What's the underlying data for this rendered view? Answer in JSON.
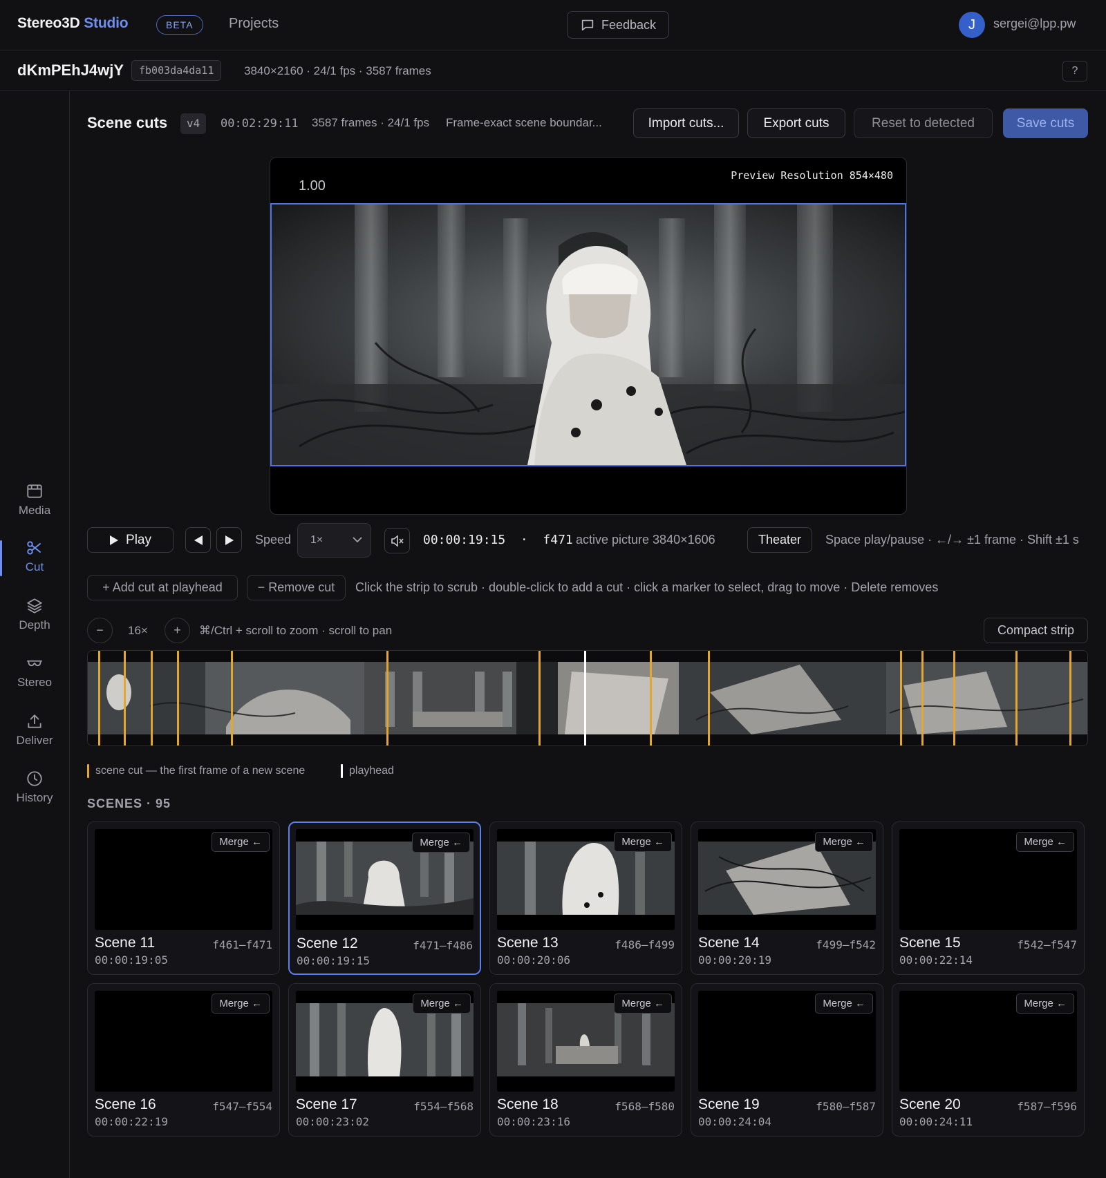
{
  "app": {
    "brand_main": "Stereo3D",
    "brand_accent": "Studio",
    "beta": "BETA",
    "projects": "Projects",
    "feedback": "Feedback",
    "avatar_initial": "J",
    "user_email": "sergei@lpp.pw"
  },
  "asset": {
    "name": "dKmPEhJ4wjY",
    "hash": "fb003da4da11",
    "meta": "3840×2160 · 24/1 fps · 3587 frames",
    "help": "?"
  },
  "sidebar": {
    "items": [
      {
        "label": "Media",
        "icon": "media-icon"
      },
      {
        "label": "Cut",
        "icon": "scissors-icon",
        "active": true
      },
      {
        "label": "Depth",
        "icon": "layers-icon"
      },
      {
        "label": "Stereo",
        "icon": "glasses-icon"
      },
      {
        "label": "Deliver",
        "icon": "upload-icon"
      },
      {
        "label": "History",
        "icon": "clock-icon"
      }
    ]
  },
  "header": {
    "title": "Scene cuts",
    "version": "v4",
    "duration": "00:02:29:11",
    "frames": "3587 frames · 24/1 fps",
    "description": "Frame-exact scene boundar...",
    "import": "Import cuts...",
    "export": "Export cuts",
    "reset": "Reset to detected",
    "save": "Save cuts"
  },
  "preview": {
    "zoom": "1.00",
    "resolution": "Preview Resolution 854×480"
  },
  "playback": {
    "play": "Play",
    "speed_label": "Speed",
    "speed_value": "1×",
    "timecode": "00:00:19:15  ·  f471",
    "active_picture": "active picture 3840×1606",
    "theater": "Theater",
    "shortcuts": "Space play/pause · ←/→ ±1 frame · Shift ±1 s"
  },
  "cut_actions": {
    "add": "+ Add cut at playhead",
    "remove": "− Remove cut",
    "help": "Click the strip to scrub · double-click to add a cut · click a marker to select, drag to move · Delete removes"
  },
  "zoom": {
    "minus": "−",
    "level": "16×",
    "plus": "+",
    "help": "⌘/Ctrl + scroll to zoom · scroll to pan",
    "compact": "Compact strip"
  },
  "legend": {
    "cut": "scene cut — the first frame of a new scene",
    "playhead": "playhead"
  },
  "colors": {
    "accent": "#6e8ff0",
    "cut_marker": "#e3a72f",
    "playhead": "#ffffff",
    "selected_border": "#5b7ff0"
  },
  "scenes": {
    "heading": "SCENES · 95",
    "merge_label": "Merge ←",
    "items": [
      {
        "name": "Scene 11",
        "range": "f461–f471",
        "time": "00:00:19:05"
      },
      {
        "name": "Scene 12",
        "range": "f471–f486",
        "time": "00:00:19:15",
        "selected": true
      },
      {
        "name": "Scene 13",
        "range": "f486–f499",
        "time": "00:00:20:06"
      },
      {
        "name": "Scene 14",
        "range": "f499–f542",
        "time": "00:00:20:19"
      },
      {
        "name": "Scene 15",
        "range": "f542–f547",
        "time": "00:00:22:14"
      },
      {
        "name": "Scene 16",
        "range": "f547–f554",
        "time": "00:00:22:19"
      },
      {
        "name": "Scene 17",
        "range": "f554–f568",
        "time": "00:00:23:02"
      },
      {
        "name": "Scene 18",
        "range": "f568–f580",
        "time": "00:00:23:16"
      },
      {
        "name": "Scene 19",
        "range": "f580–f587",
        "time": "00:00:24:04"
      },
      {
        "name": "Scene 20",
        "range": "f587–f596",
        "time": "00:00:24:11"
      }
    ]
  }
}
